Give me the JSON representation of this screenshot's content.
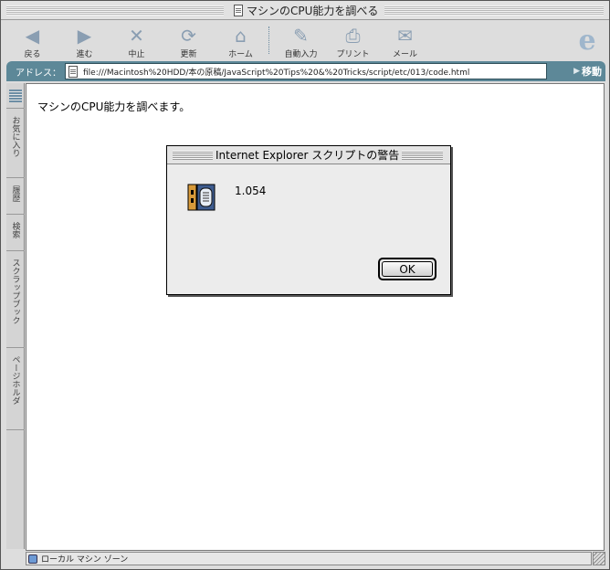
{
  "window": {
    "title": "マシンのCPU能力を調べる"
  },
  "toolbar": {
    "buttons": [
      {
        "label": "戻る",
        "icon": "back-arrow-icon",
        "glyph": "◀"
      },
      {
        "label": "進む",
        "icon": "forward-arrow-icon",
        "glyph": "▶"
      },
      {
        "label": "中止",
        "icon": "stop-x-icon",
        "glyph": "✕"
      },
      {
        "label": "更新",
        "icon": "refresh-icon",
        "glyph": "⟳"
      },
      {
        "label": "ホーム",
        "icon": "home-icon",
        "glyph": "⌂"
      },
      {
        "label": "自動入力",
        "icon": "autofill-pen-icon",
        "glyph": "✎"
      },
      {
        "label": "プリント",
        "icon": "printer-icon",
        "glyph": "⎙"
      },
      {
        "label": "メール",
        "icon": "mail-envelope-icon",
        "glyph": "✉"
      }
    ],
    "logo_glyph": "e"
  },
  "address": {
    "label": "アドレス：",
    "url": "file:///Macintosh%20HDD/本の原稿/JavaScript%20Tips%20&%20Tricks/script/etc/013/code.html",
    "go_label": "移動"
  },
  "sidebar": {
    "tabs": [
      "お気に入り",
      "履歴",
      "検索",
      "スクラップブック",
      "ページホルダ"
    ]
  },
  "page": {
    "message": "マシンのCPU能力を調べます。"
  },
  "dialog": {
    "title": "Internet Explorer スクリプトの警告",
    "message": "1.054",
    "ok_label": "OK"
  },
  "status": {
    "text": "ローカル マシン ゾーン"
  },
  "colors": {
    "address_bar": "#5d8898",
    "toolbar_icon": "#8a9eb2"
  }
}
